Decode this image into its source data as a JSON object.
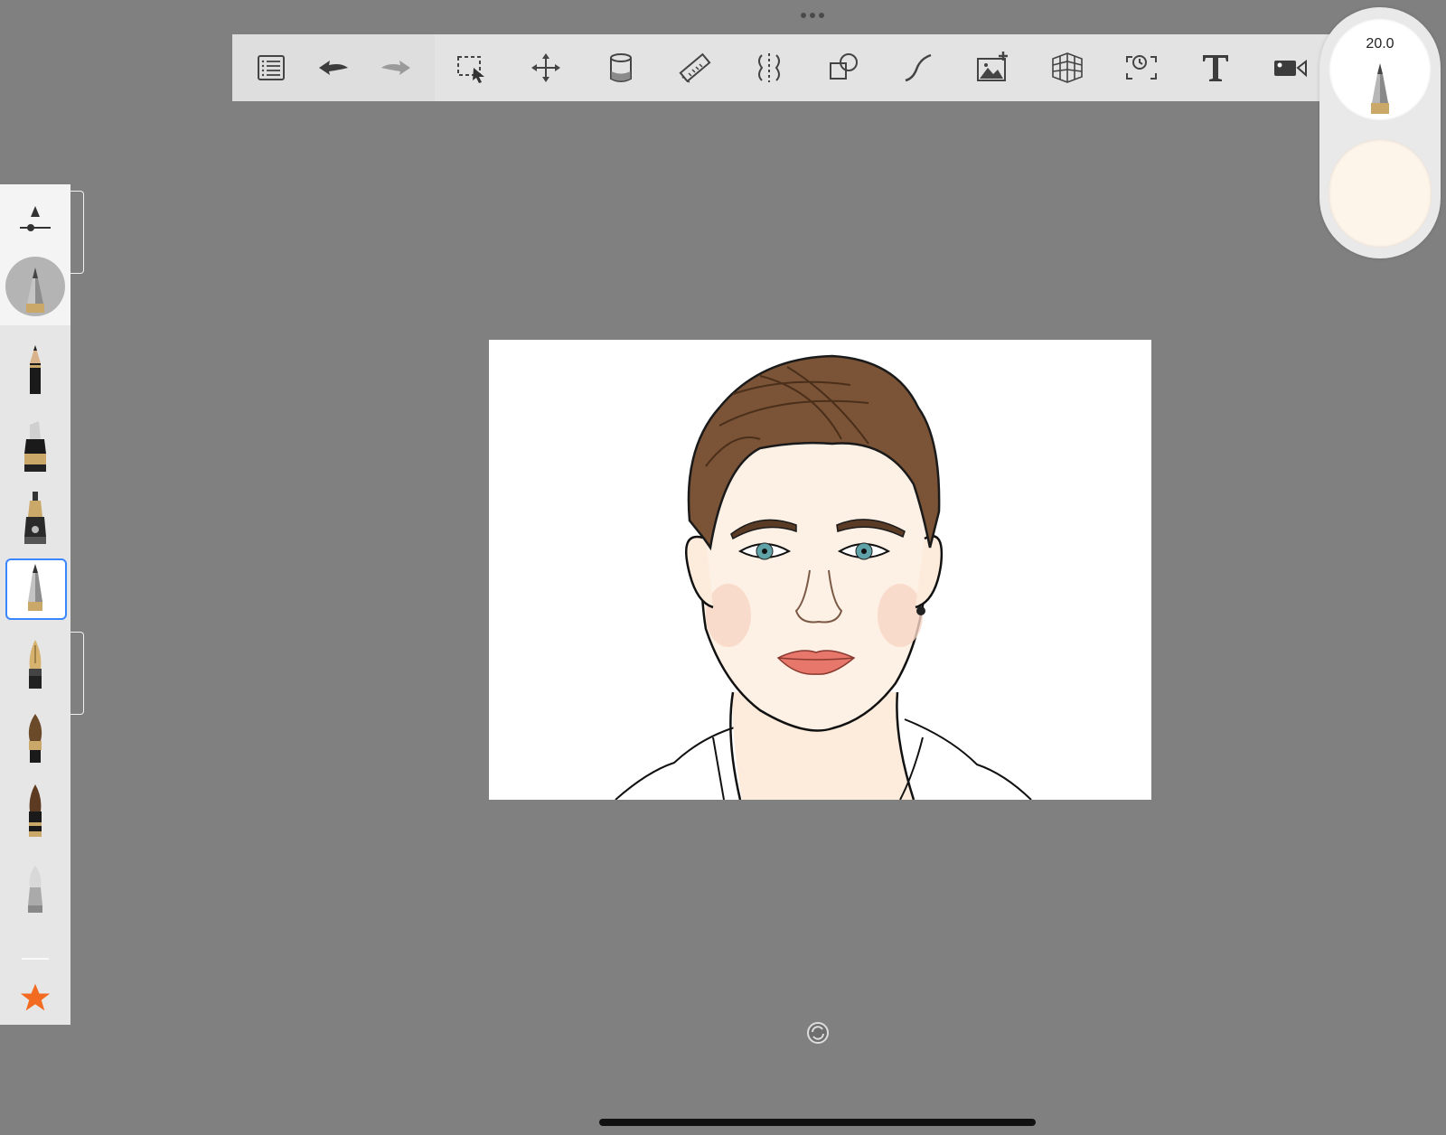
{
  "toolbar": {
    "left_tools": [
      {
        "name": "brush-library-icon",
        "id": "list"
      },
      {
        "name": "undo-icon",
        "id": "undo"
      },
      {
        "name": "redo-icon",
        "id": "redo"
      }
    ],
    "right_tools": [
      {
        "name": "selection-icon",
        "id": "select"
      },
      {
        "name": "transform-move-icon",
        "id": "move"
      },
      {
        "name": "fill-bucket-icon",
        "id": "fill"
      },
      {
        "name": "ruler-icon",
        "id": "ruler"
      },
      {
        "name": "symmetry-icon",
        "id": "symmetry"
      },
      {
        "name": "shapes-icon",
        "id": "shapes"
      },
      {
        "name": "stroke-curve-icon",
        "id": "curve"
      },
      {
        "name": "insert-image-icon",
        "id": "image"
      },
      {
        "name": "perspective-grid-icon",
        "id": "grid"
      },
      {
        "name": "time-lapse-icon",
        "id": "timelapse"
      },
      {
        "name": "text-tool-icon",
        "id": "text"
      },
      {
        "name": "video-record-icon",
        "id": "video"
      }
    ]
  },
  "brush_puck": {
    "size_value": "20.0"
  },
  "color_puck": {
    "current_color": "#fdf4ea"
  },
  "brushes": [
    {
      "name": "pencil-brush-icon"
    },
    {
      "name": "marker-brush-icon"
    },
    {
      "name": "airbrush-brush-icon"
    },
    {
      "name": "ballpoint-brush-icon",
      "selected": true
    },
    {
      "name": "fountain-pen-brush-icon"
    },
    {
      "name": "paintbrush-brush-icon"
    },
    {
      "name": "ink-brush-icon"
    },
    {
      "name": "eraser-brush-icon"
    }
  ],
  "favorites": {
    "icon": "star-icon",
    "color": "#f26b21"
  }
}
